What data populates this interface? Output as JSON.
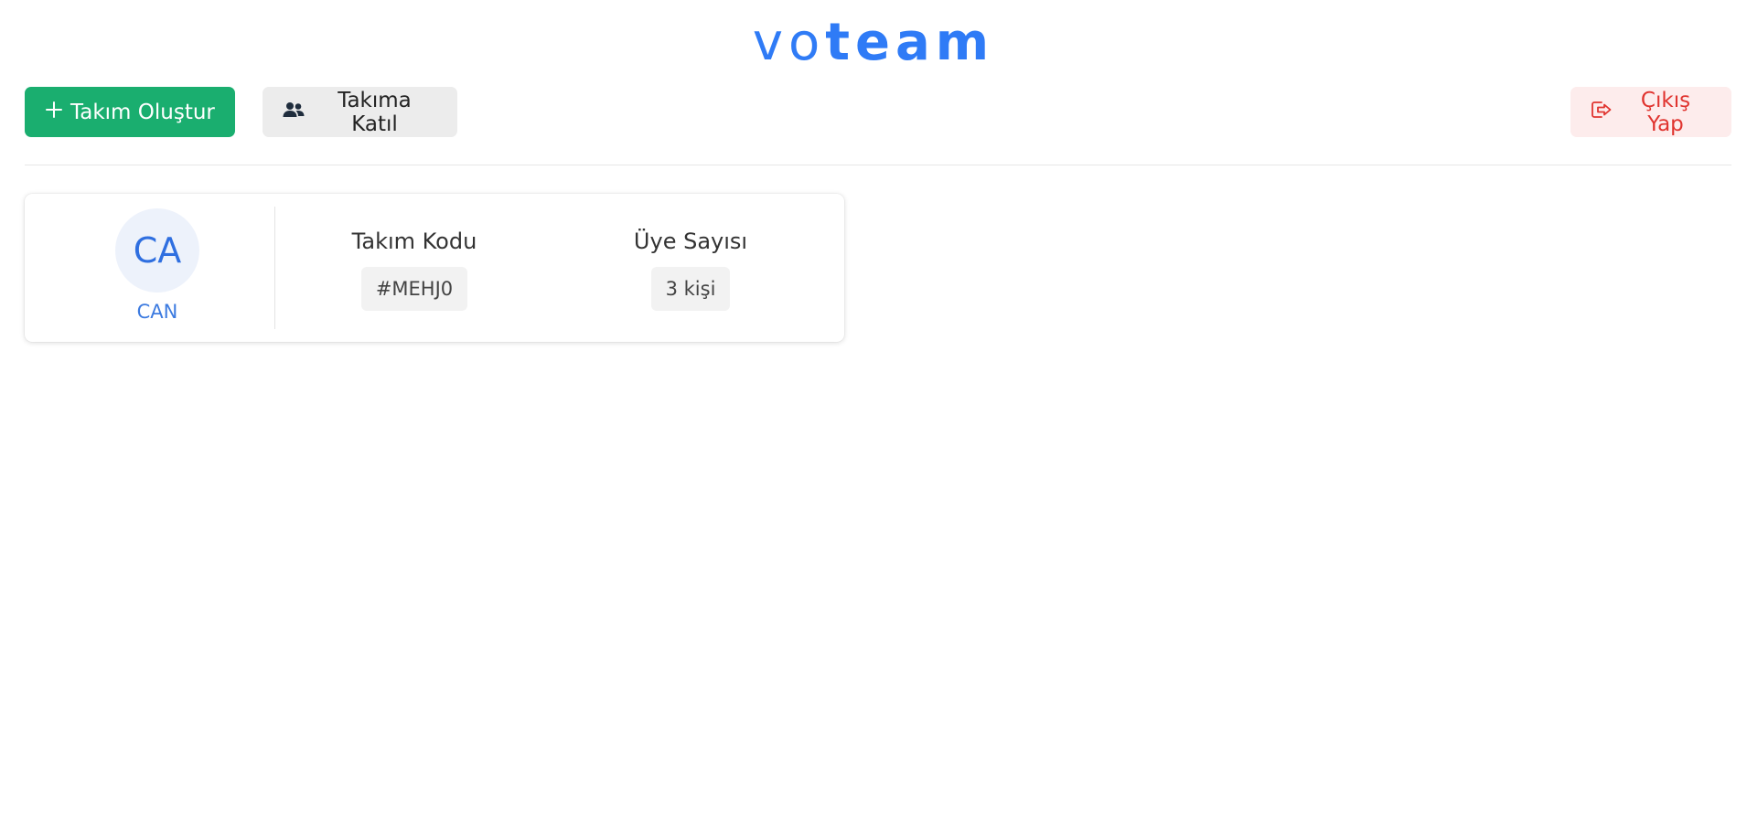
{
  "logo": {
    "light": "vo",
    "bold": "team"
  },
  "toolbar": {
    "create_label": "Takım Oluştur",
    "join_label": "Takıma Katıl",
    "logout_label": "Çıkış Yap"
  },
  "icons": {
    "create": "plus-icon",
    "join": "users-icon",
    "logout": "sign-out-icon"
  },
  "colors": {
    "brand": "#2f7bf6",
    "create_button": "#1aae6f",
    "logout_text": "#e0342f",
    "logout_bg": "#fdecec"
  },
  "team_card": {
    "avatar_initials": "CA",
    "team_name": "CAN",
    "code_label": "Takım Kodu",
    "code_value": "#MEHJ0",
    "members_label": "Üye Sayısı",
    "members_value": "3 kişi"
  }
}
